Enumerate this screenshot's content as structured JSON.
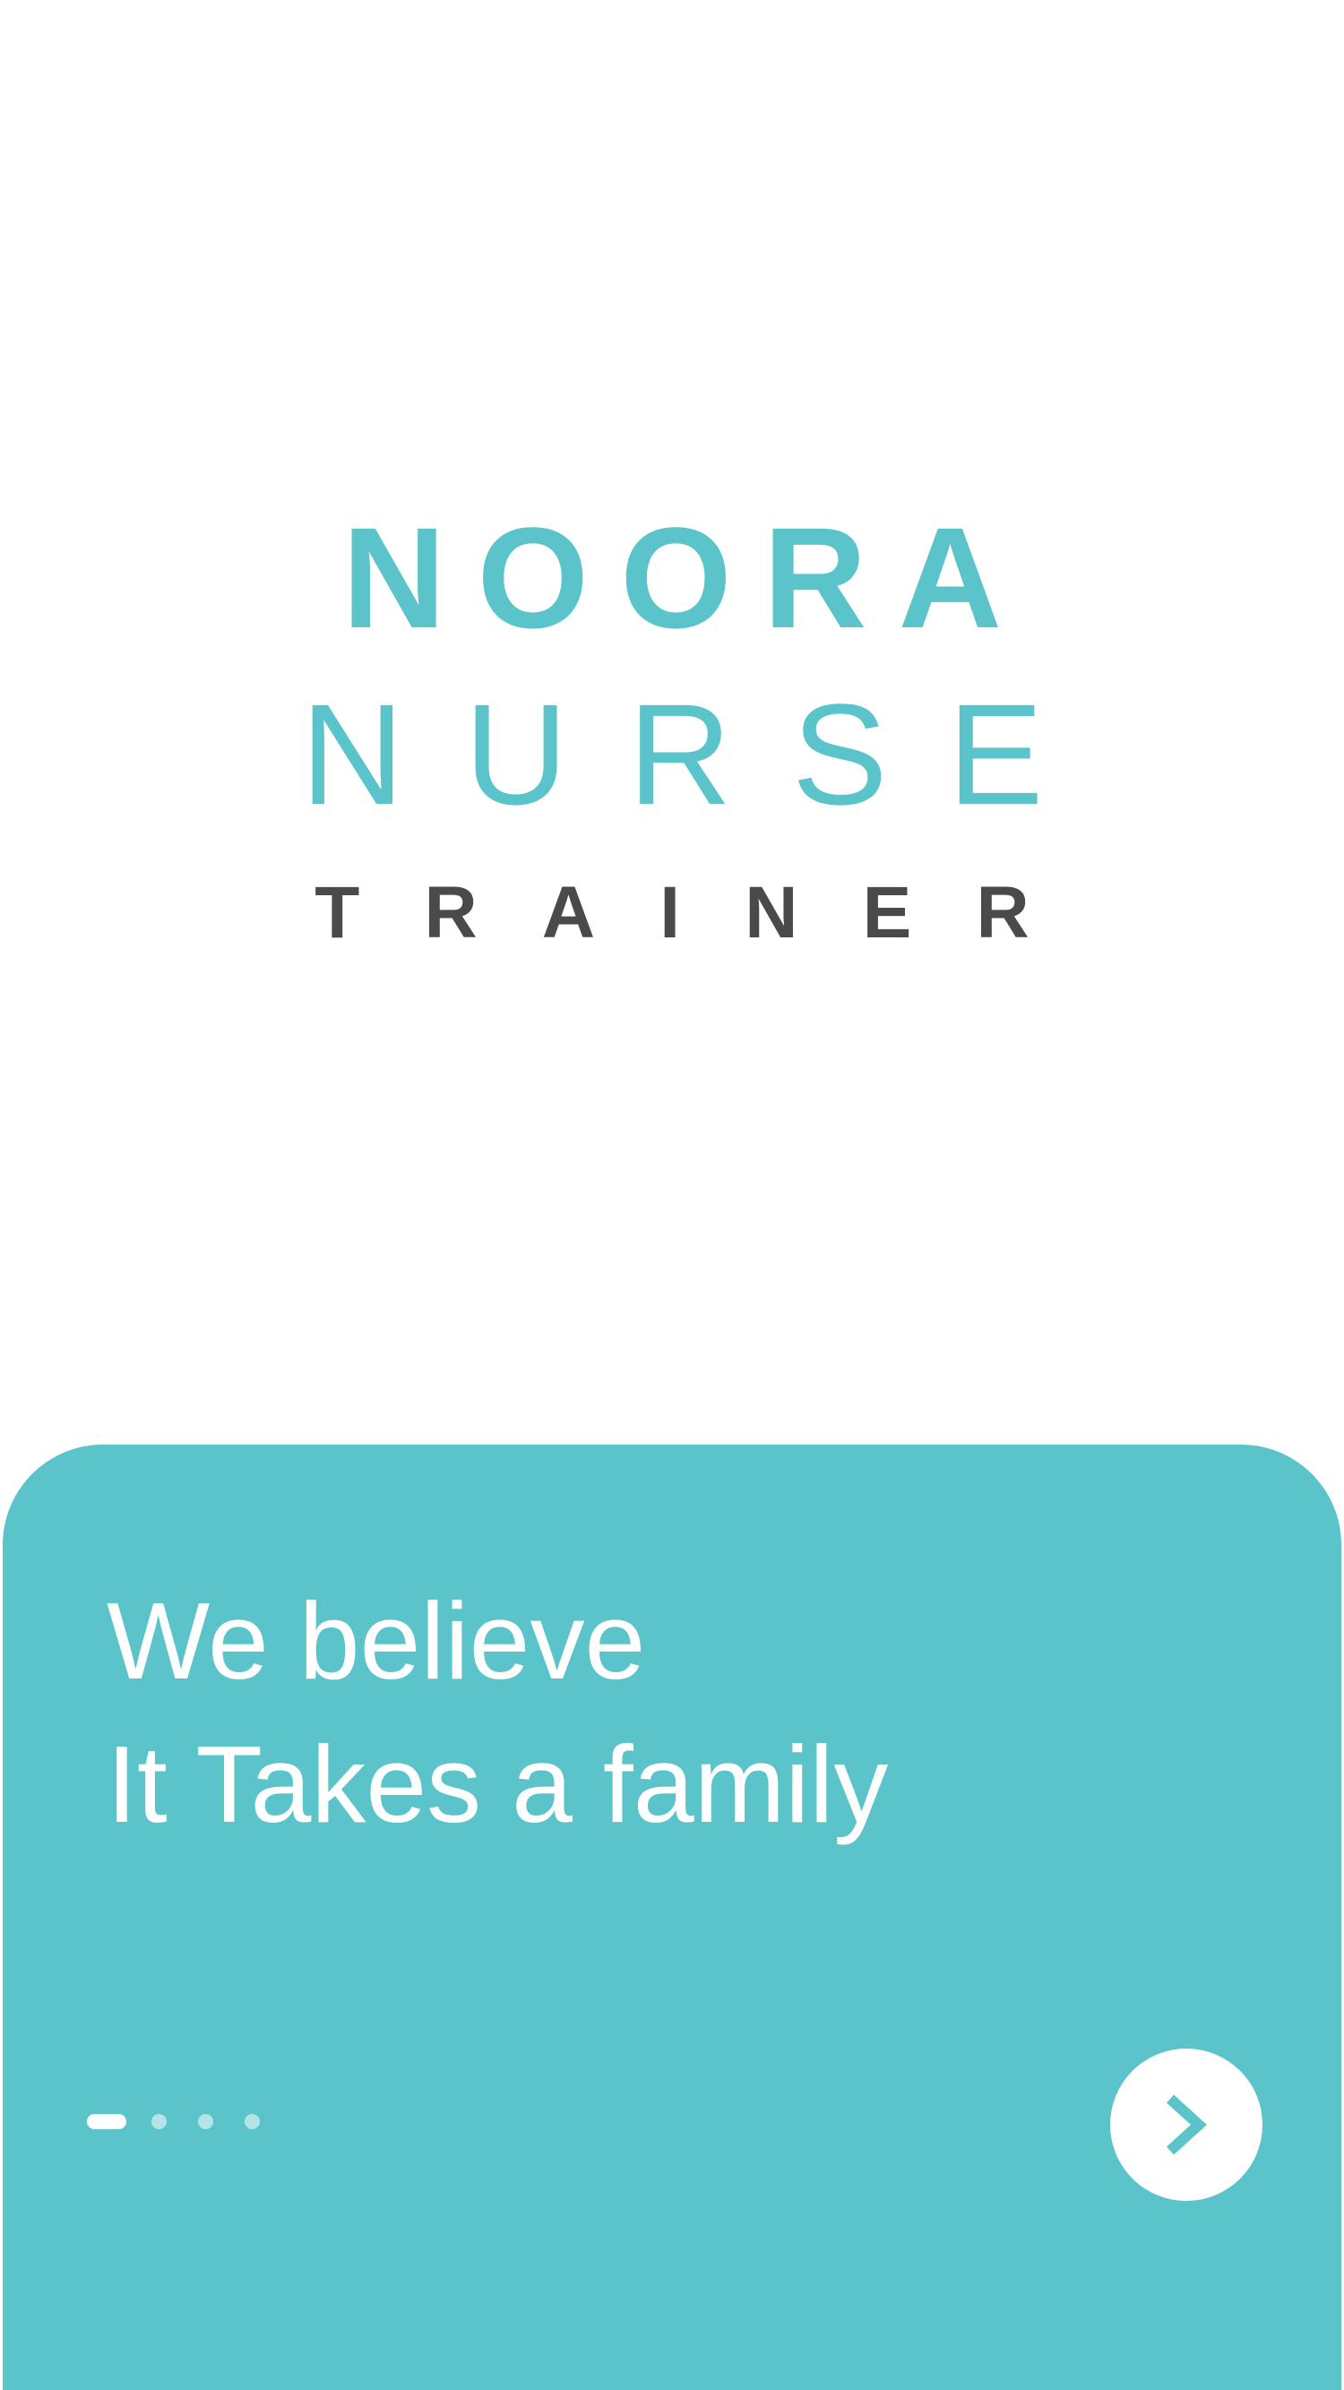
{
  "logo": {
    "line1": "NOORA",
    "line2": "NURSE",
    "line3": "TRAINER"
  },
  "onboarding": {
    "tagline_line1": "We believe",
    "tagline_line2": "It Takes a family",
    "page_indicator": {
      "current": 1,
      "total": 4
    },
    "next_button_icon": "chevron-right-icon"
  },
  "colors": {
    "brand_teal": "#5bc4cb",
    "dark_text": "#4a4a4a",
    "background": "#ffffff"
  }
}
